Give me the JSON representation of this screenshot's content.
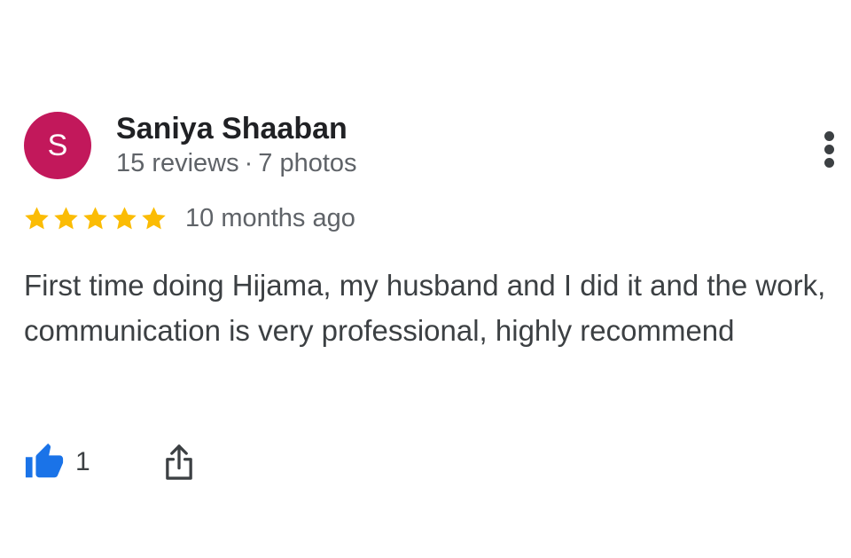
{
  "author": {
    "initial": "S",
    "name": "Saniya Shaaban",
    "reviews": "15 reviews",
    "separator": "·",
    "photos": "7 photos",
    "avatar_color": "#c2185b"
  },
  "menu": {
    "icon": "more-vert-icon"
  },
  "rating": {
    "stars": 5,
    "max": 5,
    "star_color": "#fbbc04",
    "date": "10 months ago"
  },
  "review": {
    "text": "First time doing Hijama, my husband and I did it and the work, communication is very professional, highly recommend"
  },
  "actions": {
    "like_icon": "thumbs-up-icon",
    "like_count": "1",
    "like_color": "#1a73e8",
    "share_icon": "share-icon"
  }
}
